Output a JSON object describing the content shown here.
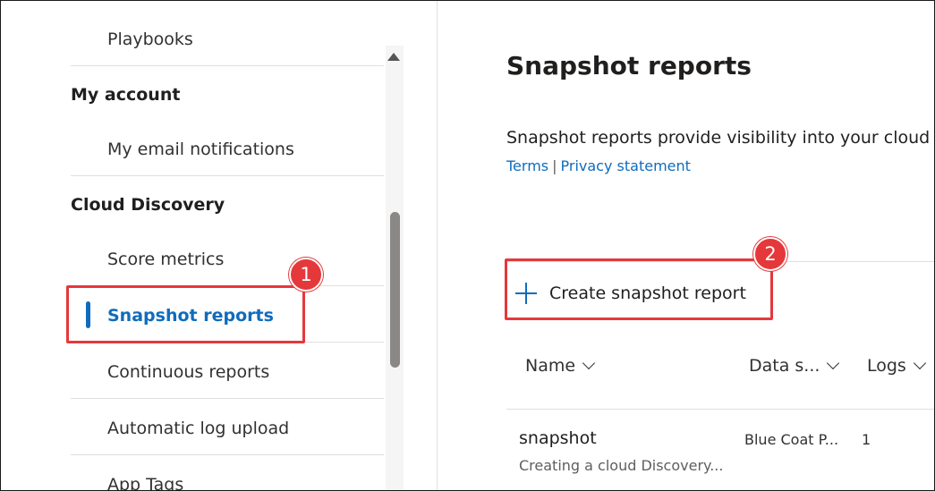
{
  "sidebar": {
    "items": [
      {
        "label": "Playbooks",
        "type": "item"
      },
      {
        "label": "My account",
        "type": "header"
      },
      {
        "label": "My email notifications",
        "type": "item"
      },
      {
        "label": "Cloud Discovery",
        "type": "header"
      },
      {
        "label": "Score metrics",
        "type": "item"
      },
      {
        "label": "Snapshot reports",
        "type": "active"
      },
      {
        "label": "Continuous reports",
        "type": "item"
      },
      {
        "label": "Automatic log upload",
        "type": "item"
      },
      {
        "label": "App Tags",
        "type": "item"
      }
    ]
  },
  "callouts": {
    "badge1": "1",
    "badge2": "2",
    "color": "#e5383b"
  },
  "main": {
    "title": "Snapshot reports",
    "description": "Snapshot reports provide visibility into your cloud ap",
    "links": {
      "terms": "Terms",
      "separator": "|",
      "privacy": "Privacy statement"
    },
    "create_button": {
      "label": "Create snapshot report",
      "icon": "plus-icon"
    },
    "table": {
      "columns": [
        {
          "label": "Name"
        },
        {
          "label": "Data s..."
        },
        {
          "label": "Logs"
        }
      ],
      "rows": [
        {
          "name": "snapshot",
          "description": "Creating a cloud Discovery...",
          "data_source": "Blue Coat P...",
          "logs": "1"
        }
      ]
    }
  },
  "colors": {
    "accent": "#0f6cbd",
    "text": "#201f1e",
    "divider": "#e1dfdd"
  }
}
